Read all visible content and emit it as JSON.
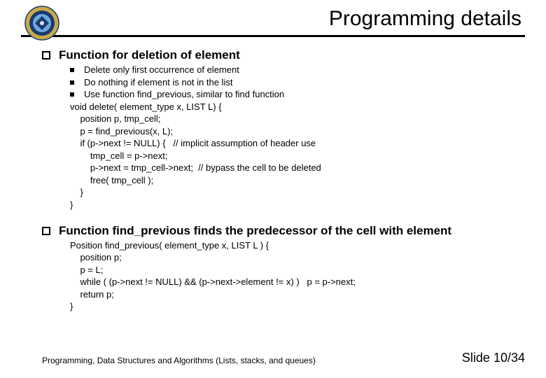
{
  "title": "Programming details",
  "sections": [
    {
      "heading": "Function for deletion of element",
      "bullets": [
        "Delete only first  occurrence of element",
        "Do nothing if element is not in the list",
        "Use function find_previous, similar to find function"
      ],
      "code": "void delete( element_type x, LIST L) {\n    position p, tmp_cell;\n    p = find_previous(x, L);\n    if (p->next != NULL) {   // implicit assumption of header use\n        tmp_cell = p->next;\n        p->next = tmp_cell->next;  // bypass the cell to be deleted\n        free( tmp_cell );\n    }\n}"
    },
    {
      "heading": "Function find_previous finds the predecessor of the cell with element",
      "bullets": [],
      "code": "Position find_previous( element_type x, LIST L ) {\n    position p;\n    p = L;\n    while ( (p->next != NULL) && (p->next->element != x) )   p = p->next;\n    return p;\n}"
    }
  ],
  "footer": {
    "left": "Programming, Data Structures and Algorithms  (Lists, stacks, and queues)",
    "right": "Slide 10/34"
  }
}
